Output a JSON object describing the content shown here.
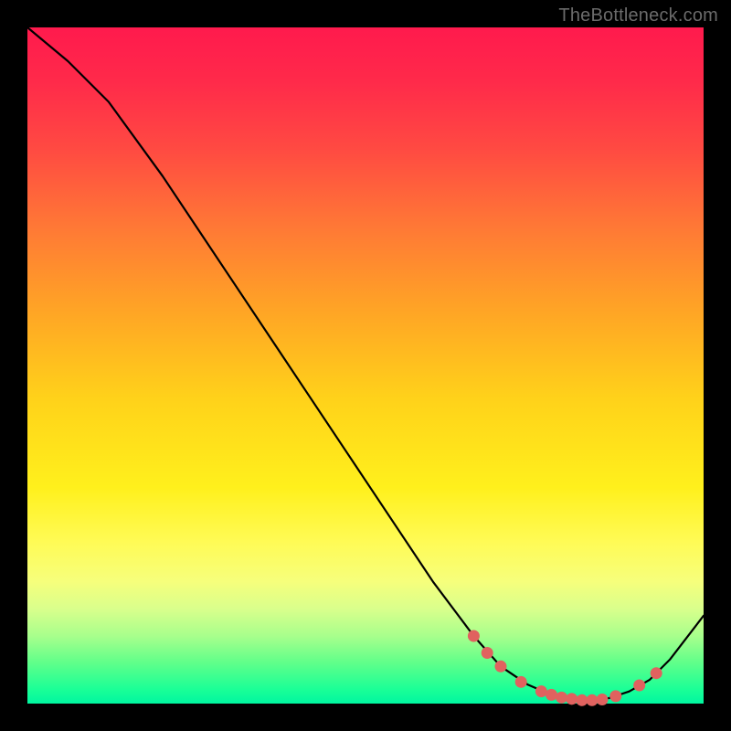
{
  "watermark": "TheBottleneck.com",
  "chart_data": {
    "type": "line",
    "title": "",
    "xlabel": "",
    "ylabel": "",
    "xlim": [
      0,
      100
    ],
    "ylim": [
      0,
      100
    ],
    "series": [
      {
        "name": "bottleneck-curve",
        "x": [
          0,
          6,
          12,
          20,
          30,
          40,
          50,
          60,
          66,
          70,
          74,
          77,
          80,
          83,
          86,
          89,
          92,
          95,
          100
        ],
        "values": [
          100,
          95,
          89,
          78,
          63,
          48,
          33,
          18,
          10,
          5.5,
          2.8,
          1.5,
          0.8,
          0.5,
          0.8,
          1.8,
          3.5,
          6.5,
          13
        ]
      }
    ],
    "markers": {
      "name": "highlight-dots",
      "points": [
        {
          "x": 66,
          "y": 10
        },
        {
          "x": 68,
          "y": 7.5
        },
        {
          "x": 70,
          "y": 5.5
        },
        {
          "x": 73,
          "y": 3.2
        },
        {
          "x": 76,
          "y": 1.8
        },
        {
          "x": 77.5,
          "y": 1.3
        },
        {
          "x": 79,
          "y": 0.9
        },
        {
          "x": 80.5,
          "y": 0.7
        },
        {
          "x": 82,
          "y": 0.5
        },
        {
          "x": 83.5,
          "y": 0.5
        },
        {
          "x": 85,
          "y": 0.6
        },
        {
          "x": 87,
          "y": 1.1
        },
        {
          "x": 90.5,
          "y": 2.7
        },
        {
          "x": 93,
          "y": 4.5
        }
      ]
    }
  }
}
